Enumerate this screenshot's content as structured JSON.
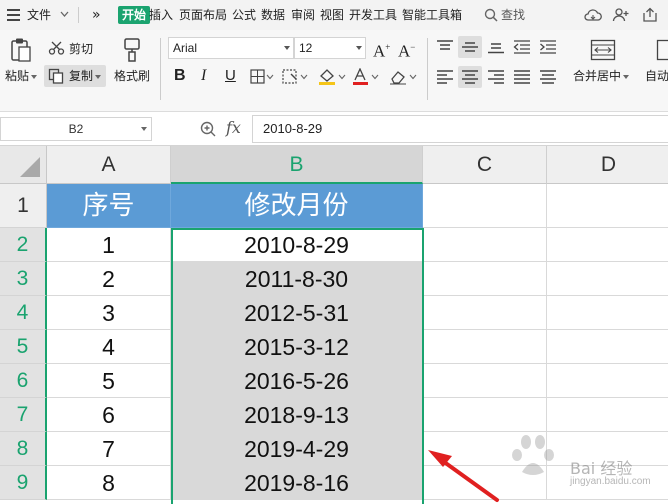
{
  "menu": {
    "file": "文件",
    "more": "»",
    "tabs": [
      "开始",
      "插入",
      "页面布局",
      "公式",
      "数据",
      "审阅",
      "视图",
      "开发工具",
      "智能工具箱"
    ],
    "search": "查找"
  },
  "ribbon": {
    "paste": "粘贴",
    "cut": "剪切",
    "copy": "复制",
    "format_painter": "格式刷",
    "font_name": "Arial",
    "font_size": "12",
    "merge_center": "合并居中",
    "auto_wrap": "自动"
  },
  "formula": {
    "name_box": "B2",
    "fx": "fx",
    "value": "2010-8-29"
  },
  "sheet": {
    "columns": [
      "A",
      "B",
      "C",
      "D"
    ],
    "rows": [
      "1",
      "2",
      "3",
      "4",
      "5",
      "6",
      "7",
      "8",
      "9"
    ],
    "header": [
      "序号",
      "修改月份"
    ],
    "data": [
      [
        "1",
        "2010-8-29"
      ],
      [
        "2",
        "2011-8-30"
      ],
      [
        "3",
        "2012-5-31"
      ],
      [
        "4",
        "2015-3-12"
      ],
      [
        "5",
        "2016-5-26"
      ],
      [
        "6",
        "2018-9-13"
      ],
      [
        "7",
        "2019-4-29"
      ],
      [
        "8",
        "2019-8-16"
      ]
    ]
  },
  "watermark": {
    "brand": "Bai 经验",
    "url": "jingyan.baidu.com"
  },
  "colors": {
    "accent": "#1aa36f",
    "header_fill": "#5b9bd5",
    "arrow": "#e02020"
  }
}
